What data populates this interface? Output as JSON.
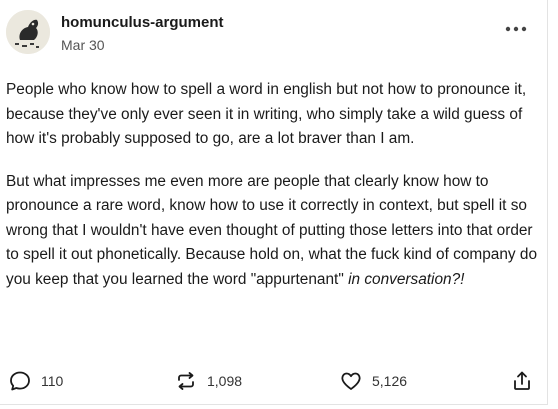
{
  "post": {
    "author": "homunculus-argument",
    "date": "Mar 30",
    "paragraph1": "People who know how to spell a word in english but not how to pronounce it, because they've only ever seen it in writing, who simply take a wild guess of how it's probably supposed to go, are a lot braver than I am.",
    "paragraph2_main": "But what impresses me even more are people that clearly know how to pronounce a rare word, know how to use it correctly in context, but spell it so wrong that I wouldn't have even thought of putting those letters into that order to spell it out phonetically. Because hold on, what the fuck kind of company do you keep that you learned the word \"appurtenant\" ",
    "paragraph2_italic": "in conversation?!"
  },
  "actions": {
    "replies": "110",
    "reblogs": "1,098",
    "likes": "5,126"
  },
  "icons": {
    "avatar": "dark-creature-avatar",
    "more": "ellipsis-icon",
    "replies": "speech-bubble-icon",
    "reblogs": "reblog-arrows-icon",
    "likes": "heart-icon",
    "share": "share-icon"
  }
}
